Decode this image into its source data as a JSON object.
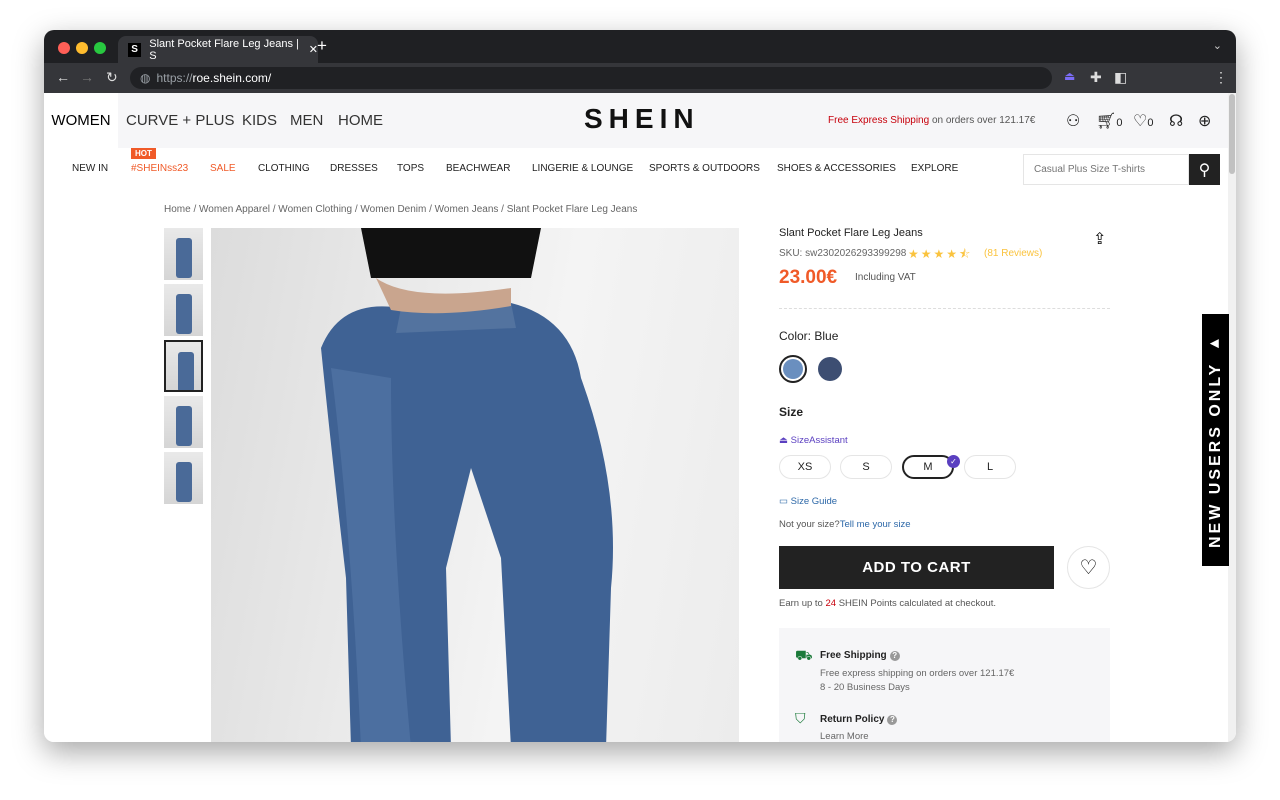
{
  "browser": {
    "tab_title": "Slant Pocket Flare Leg Jeans | S",
    "favicon": "S",
    "url_prefix": "https://",
    "url_host": "roe.shein.com/"
  },
  "header": {
    "categories": [
      "WOMEN",
      "CURVE + PLUS",
      "KIDS",
      "MEN",
      "HOME"
    ],
    "logo": "SHEIN",
    "shipping_highlight": "Free Express Shipping",
    "shipping_rest": " on orders over 121.17€",
    "cart_count": "0",
    "wish_count": "0"
  },
  "nav": {
    "hot_badge": "HOT",
    "items": [
      "NEW IN",
      "#SHEINss23",
      "SALE",
      "CLOTHING",
      "DRESSES",
      "TOPS",
      "BEACHWEAR",
      "LINGERIE & LOUNGE",
      "SPORTS & OUTDOORS",
      "SHOES & ACCESSORIES",
      "EXPLORE"
    ],
    "search_placeholder": "Casual Plus Size T-shirts"
  },
  "breadcrumb": "Home / Women Apparel / Women Clothing / Women Denim / Women Jeans / Slant Pocket Flare Leg Jeans",
  "product": {
    "title": "Slant Pocket Flare Leg Jeans",
    "sku": "SKU: sw2302026293399298",
    "rating": 4.5,
    "stars": "★★★★⯪",
    "reviews": "(81 Reviews)",
    "price": "23.00€",
    "vat": "Including VAT",
    "color_label": "Color:",
    "color_value": "Blue",
    "colors": [
      "#6a8fbf",
      "#3d4e72"
    ],
    "size_label": "Size",
    "size_assistant": "SizeAssistant",
    "sizes": [
      "XS",
      "S",
      "M",
      "L"
    ],
    "selected_size": "M",
    "size_guide": "Size Guide",
    "not_size": "Not your size?",
    "tell_size": "Tell me your size",
    "add_to_cart": "ADD TO CART",
    "points_pre": "Earn up to ",
    "points": "24",
    "points_post": " SHEIN Points calculated at checkout."
  },
  "info": {
    "shipping_title": "Free Shipping",
    "shipping_line1": "Free express shipping on orders over 121.17€",
    "shipping_line2": "8 - 20 Business Days",
    "return_title": "Return Policy",
    "return_link": "Learn More"
  },
  "promo": "NEW USERS ONLY ▸"
}
